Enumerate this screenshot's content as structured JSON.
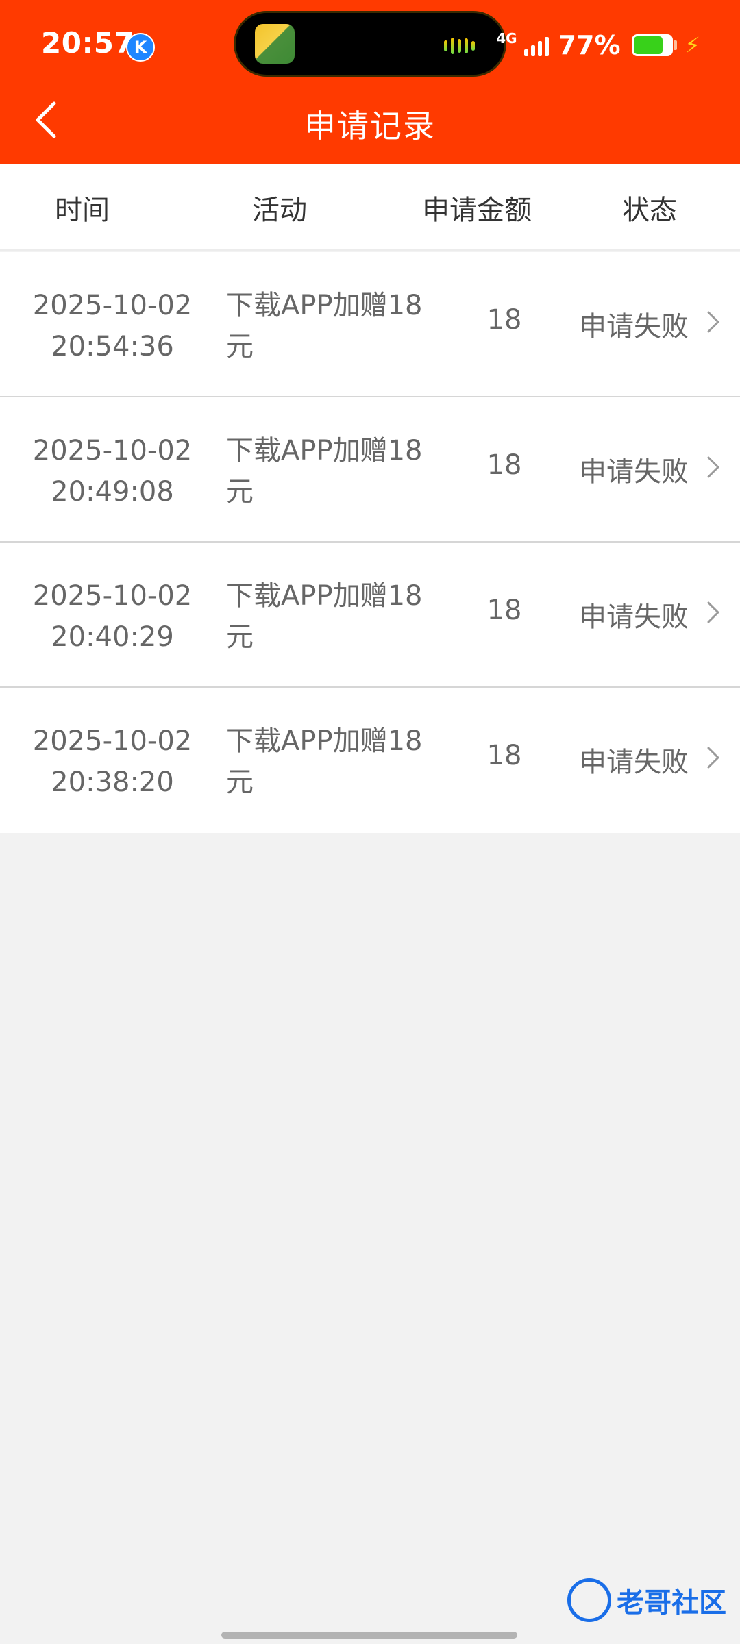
{
  "status_bar": {
    "time": "20:57",
    "badge": "K",
    "network": "4G",
    "battery_percent": "77%",
    "battery_level": 0.77
  },
  "nav": {
    "back_icon": "chevron-left-icon",
    "title": "申请记录"
  },
  "table": {
    "headers": [
      "时间",
      "活动",
      "申请金额",
      "状态"
    ],
    "rows": [
      {
        "date": "2025-10-02",
        "time": "20:54:36",
        "activity_line1": "下载APP加赠18",
        "activity_line2": "元",
        "amount": "18",
        "status": "申请失败"
      },
      {
        "date": "2025-10-02",
        "time": "20:49:08",
        "activity_line1": "下载APP加赠18",
        "activity_line2": "元",
        "amount": "18",
        "status": "申请失败"
      },
      {
        "date": "2025-10-02",
        "time": "20:40:29",
        "activity_line1": "下载APP加赠18",
        "activity_line2": "元",
        "amount": "18",
        "status": "申请失败"
      },
      {
        "date": "2025-10-02",
        "time": "20:38:20",
        "activity_line1": "下载APP加赠18",
        "activity_line2": "元",
        "amount": "18",
        "status": "申请失败"
      }
    ]
  },
  "watermark": {
    "text": "老哥社区"
  },
  "colors": {
    "brand": "#ff3a00",
    "background": "#f2f2f2",
    "text_primary": "#333333",
    "text_secondary": "#666666"
  }
}
